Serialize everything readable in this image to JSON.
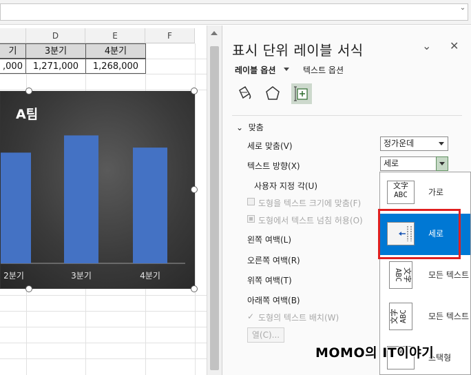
{
  "sheet": {
    "columns": [
      "D",
      "E",
      "F"
    ],
    "header_row": [
      "기",
      "3분기",
      "4분기"
    ],
    "value_row": [
      ",000",
      "1,271,000",
      "1,268,000"
    ]
  },
  "chart_data": {
    "type": "bar",
    "title": "A팀",
    "categories": [
      "2분기",
      "3분기",
      "4분기"
    ],
    "values": [
      1100000,
      1271000,
      1150000
    ],
    "ylim": [
      0,
      1500000
    ],
    "xlabel": "",
    "ylabel": "",
    "grid": false,
    "bar_color": "#4472c4"
  },
  "pane": {
    "title": "표시 단위 레이블 서식",
    "tab_label_options": "레이블 옵션",
    "tab_text_options": "텍스트 옵션",
    "section": "맞춤",
    "vertical_align_label": "세로 맞춤(V)",
    "vertical_align_value": "정가운데",
    "text_direction_label": "텍스트 방향(X)",
    "text_direction_value": "세로",
    "custom_angle_label": "사용자 지정 각(U)",
    "resize_shape_label": "도형을 텍스트 크기에 맞춤(F)",
    "overflow_label": "도형에서 텍스트 넘침 허용(O)",
    "left_margin_label": "왼쪽 여백(L)",
    "right_margin_label": "오른쪽 여백(R)",
    "top_margin_label": "위쪽 여백(T)",
    "bottom_margin_label": "아래쪽 여백(B)",
    "wrap_label": "도형의 텍스트 배치(W)",
    "columns_button": "열(C)..."
  },
  "direction_options": [
    {
      "label": "가로",
      "icon_top": "文字",
      "icon_bottom": "ABC"
    },
    {
      "label": "세로",
      "icon_top": "",
      "icon_bottom": ""
    },
    {
      "label": "모든 텍스트",
      "icon_top": "文字",
      "icon_bottom": "ABC"
    },
    {
      "label": "모든 텍스트",
      "icon_top": "文字",
      "icon_bottom": "ABC"
    },
    {
      "label": "스택형",
      "icon_top": "字",
      "icon_bottom": ""
    }
  ],
  "watermark": "MOMO의 IT이야기",
  "colors": {
    "accent": "#0078d4",
    "highlight_box": "#e02020",
    "selected_icon_bg": "#cdd9cd"
  }
}
